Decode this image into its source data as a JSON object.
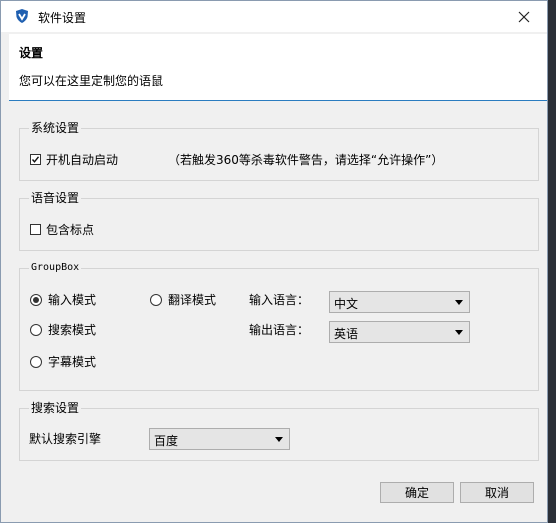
{
  "window": {
    "title": "软件设置"
  },
  "header": {
    "title": "设置",
    "subtitle": "您可以在这里定制您的语鼠"
  },
  "system_group": {
    "label": "系统设置",
    "autostart_label": "开机自动启动",
    "autostart_checked": true,
    "note": "（若触发360等杀毒软件警告，请选择“允许操作”）"
  },
  "voice_group": {
    "label": "语音设置",
    "punctuation_label": "包含标点",
    "punctuation_checked": false
  },
  "mode_group": {
    "label": "GroupBox",
    "modes": [
      "输入模式",
      "翻译模式",
      "搜索模式",
      "字幕模式"
    ],
    "selected_mode": "输入模式",
    "input_lang_label": "输入语言：",
    "input_lang_value": "中文",
    "output_lang_label": "输出语言：",
    "output_lang_value": "英语"
  },
  "search_group": {
    "label": "搜索设置",
    "engine_label": "默认搜索引擎",
    "engine_value": "百度"
  },
  "footer": {
    "ok_label": "确定",
    "cancel_label": "取消"
  },
  "colors": {
    "header_rule": "#2a7cc0",
    "app_icon": "#1f5fb0"
  }
}
